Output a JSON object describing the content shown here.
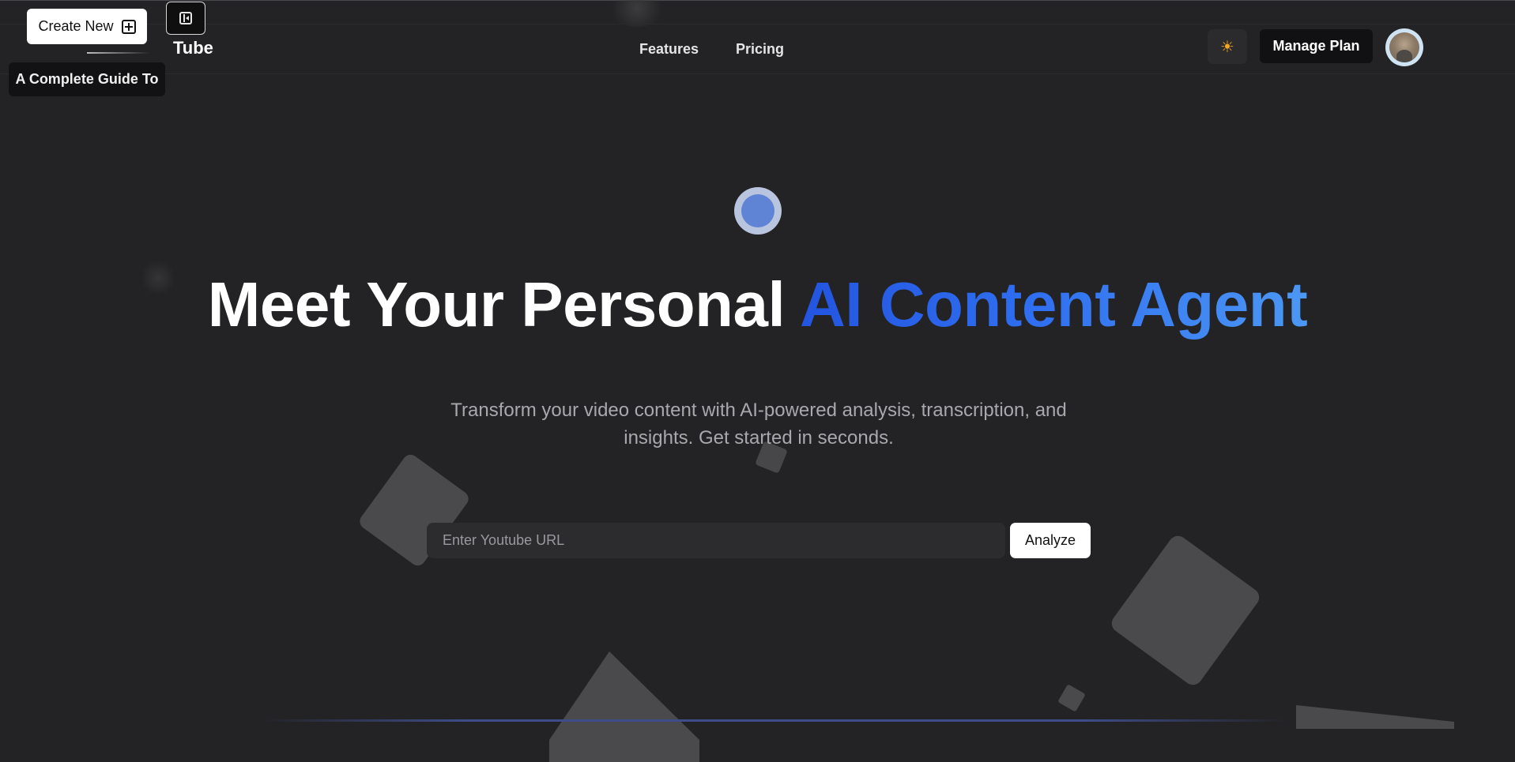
{
  "overlay": {
    "create_new_label": "Create New",
    "guide_chip": "A Complete Guide To"
  },
  "header": {
    "brand": "Tube",
    "nav": [
      {
        "label": "Features"
      },
      {
        "label": "Pricing"
      }
    ],
    "theme_icon": "sun-icon",
    "manage_plan_label": "Manage Plan"
  },
  "hero": {
    "title_plain": "Meet Your Personal",
    "title_accent": "AI Content Agent",
    "subtitle": "Transform your video content with AI-powered analysis, transcription, and insights. Get started in seconds.",
    "input_placeholder": "Enter Youtube URL",
    "analyze_label": "Analyze"
  },
  "colors": {
    "background": "#232325",
    "accent_start": "#2355e0",
    "accent_end": "#4c97f5",
    "theme_icon": "#f5a524"
  }
}
